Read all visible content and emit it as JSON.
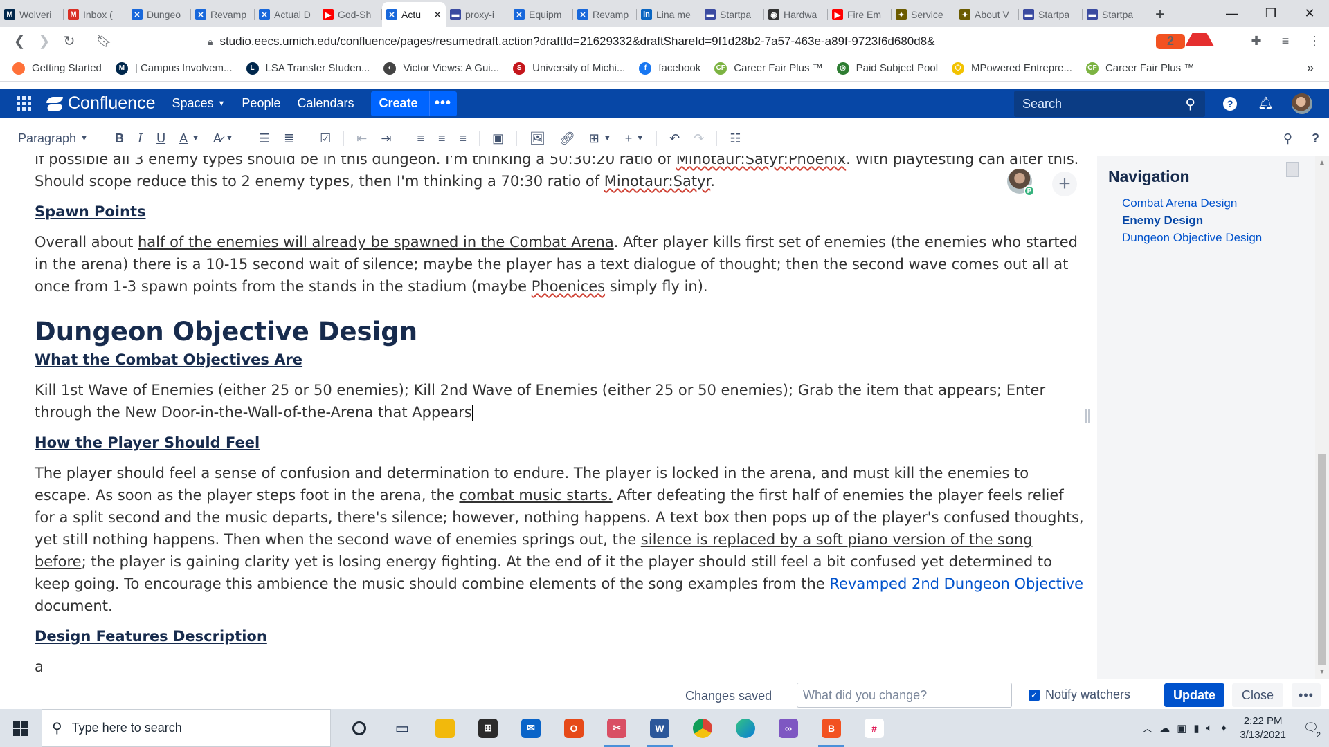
{
  "browser": {
    "tabs": [
      {
        "title": "Wolveri",
        "favicon_color": "#00274c",
        "favicon": "M"
      },
      {
        "title": "Inbox (",
        "favicon_color": "#d93025",
        "favicon": "M"
      },
      {
        "title": "Dungeo",
        "favicon_color": "#1868db",
        "favicon": "✕"
      },
      {
        "title": "Revamp",
        "favicon_color": "#1868db",
        "favicon": "✕"
      },
      {
        "title": "Actual D",
        "favicon_color": "#1868db",
        "favicon": "✕"
      },
      {
        "title": "God-Sh",
        "favicon_color": "#ff0000",
        "favicon": "▶"
      },
      {
        "title": "Actu",
        "favicon_color": "#1868db",
        "favicon": "✕",
        "active": true
      },
      {
        "title": "proxy-i",
        "favicon_color": "#3b4ba1",
        "favicon": "▬"
      },
      {
        "title": "Equipm",
        "favicon_color": "#1868db",
        "favicon": "✕"
      },
      {
        "title": "Revamp",
        "favicon_color": "#1868db",
        "favicon": "✕"
      },
      {
        "title": "Lina me",
        "favicon_color": "#0a66c2",
        "favicon": "in"
      },
      {
        "title": "Startpa",
        "favicon_color": "#3b4ba1",
        "favicon": "▬"
      },
      {
        "title": "Hardwa",
        "favicon_color": "#333333",
        "favicon": "◉"
      },
      {
        "title": "Fire Em",
        "favicon_color": "#ff0000",
        "favicon": "▶"
      },
      {
        "title": "Service",
        "favicon_color": "#6b5b00",
        "favicon": "✦"
      },
      {
        "title": "About V",
        "favicon_color": "#6b5b00",
        "favicon": "✦"
      },
      {
        "title": "Startpa",
        "favicon_color": "#3b4ba1",
        "favicon": "▬"
      },
      {
        "title": "Startpa",
        "favicon_color": "#3b4ba1",
        "favicon": "▬"
      }
    ],
    "url": "studio.eecs.umich.edu/confluence/pages/resumedraft.action?draftId=21629332&draftShareId=9f1d28b2-7a57-463e-a89f-9723f6d680d8&",
    "brave_badge": "2",
    "bookmarks": [
      {
        "label": "Getting Started",
        "color": "#ff7139",
        "glyph": ""
      },
      {
        "label": "| Campus Involvem...",
        "color": "#00274c",
        "glyph": "M"
      },
      {
        "label": "LSA Transfer Studen...",
        "color": "#00274c",
        "glyph": "L"
      },
      {
        "label": "Victor Views: A Gui...",
        "color": "#444444",
        "glyph": "◐"
      },
      {
        "label": "University of Michi...",
        "color": "#c4161c",
        "glyph": "S"
      },
      {
        "label": "facebook",
        "color": "#1877f2",
        "glyph": "f"
      },
      {
        "label": "Career Fair Plus ™",
        "color": "#7cb342",
        "glyph": "CF"
      },
      {
        "label": "Paid Subject Pool",
        "color": "#2e7d32",
        "glyph": "◎"
      },
      {
        "label": "MPowered Entrepre...",
        "color": "#f2c200",
        "glyph": "⬡"
      },
      {
        "label": "Career Fair Plus ™",
        "color": "#7cb342",
        "glyph": "CF"
      }
    ]
  },
  "confluence": {
    "logo_text": "Confluence",
    "nav": [
      "Spaces",
      "People",
      "Calendars"
    ],
    "create_label": "Create",
    "search_placeholder": "Search"
  },
  "toolbar": {
    "paragraph_style": "Paragraph"
  },
  "document": {
    "intro_line_1": "If possible all 3 enemy types should be in this dungeon. I'm thinking a 50:30:20 ratio of ",
    "intro_ratio_1": "Minotaur:Satyr:Phoenix",
    "intro_line_2": ". With playtesting can alter this. Should scope reduce this to 2 enemy types, then I'm thinking a 70:30 ratio of ",
    "intro_ratio_2": "Minotaur:Satyr",
    "intro_end": ".",
    "spawn_heading": "Spawn Points",
    "spawn_p_start": "Overall about ",
    "spawn_p_underlined": "half of the enemies will already be spawned in the Combat Arena",
    "spawn_p_mid": ". After player kills first set of enemies (the enemies who started in the arena) there is a 10-15 second wait of silence; maybe the player has a text dialogue of thought; then the second wave comes out all at once from 1-3 spawn points from the stands in the stadium (maybe ",
    "spawn_p_spell": "Phoenices",
    "spawn_p_end": " simply fly in).",
    "objective_title": "Dungeon Objective Design",
    "combat_heading": "What the Combat Objectives Are",
    "combat_p": "Kill 1st Wave of Enemies (either 25 or 50 enemies); Kill 2nd Wave of Enemies (either 25 or 50 enemies); Grab the item that appears; Enter through the New Door-in-the-Wall-of-the-Arena that Appears",
    "feel_heading": "How the Player Should Feel",
    "feel_p1": "The player should feel a sense of confusion and determination to endure. The player is locked in the arena, and must kill the enemies to escape. As soon as the player steps foot in the arena, the ",
    "feel_u1": "combat music starts.",
    "feel_p2": " After defeating the first half of enemies the player feels relief for a split second and the music departs, there's silence; however, nothing happens. A text box then pops up of the player's confused thoughts, yet still nothing happens. Then when the second wave of enemies springs out, the ",
    "feel_u2": "silence is replaced by a soft piano version of the song before",
    "feel_p3": "; the player is gaining clarity yet is losing energy fighting. At the end of it the player should still feel a bit confused yet determined to keep going. To encourage this ambience the music should combine elements of the song examples from the ",
    "feel_link": "Revamped 2nd Dungeon Objective",
    "feel_p4": " document.",
    "features_heading": "Design Features Description",
    "features_p": "a",
    "collab_badge": "P"
  },
  "navigation": {
    "title": "Navigation",
    "items": [
      {
        "label": "Combat Arena Design"
      },
      {
        "label": "Enemy Design",
        "current": true
      },
      {
        "label": "Dungeon Objective Design"
      }
    ]
  },
  "footer": {
    "status": "Changes saved",
    "message_placeholder": "What did you change?",
    "notify_label": "Notify watchers",
    "notify_checked": true,
    "update_label": "Update",
    "close_label": "Close"
  },
  "taskbar": {
    "search_placeholder": "Type here to search",
    "time": "2:22 PM",
    "date": "3/13/2021",
    "notification_count": "2"
  }
}
